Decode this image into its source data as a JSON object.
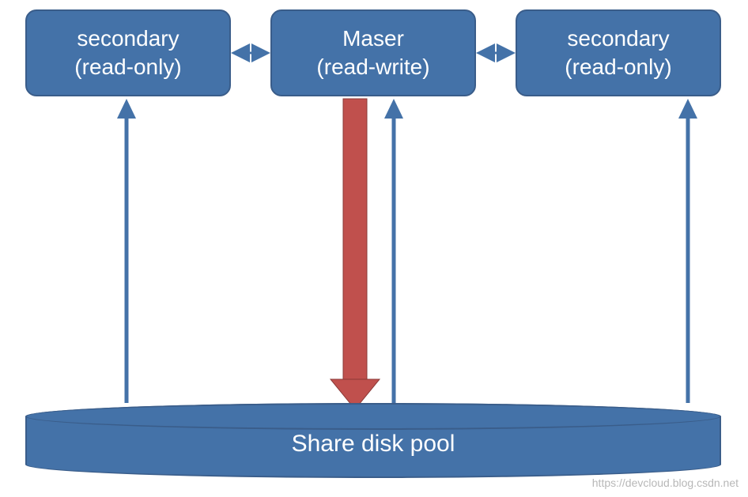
{
  "nodes": {
    "secondary_left": {
      "line1": "secondary",
      "line2": "(read-only)"
    },
    "master": {
      "line1": "Maser",
      "line2": "(read-write)"
    },
    "secondary_right": {
      "line1": "secondary",
      "line2": "(read-only)"
    }
  },
  "disk": {
    "label": "Share disk pool"
  },
  "watermark": "https://devcloud.blog.csdn.net",
  "colors": {
    "box_fill": "#4472a8",
    "box_border": "#3a5d8a",
    "arrow_blue": "#4472a8",
    "arrow_red": "#c0504d"
  }
}
